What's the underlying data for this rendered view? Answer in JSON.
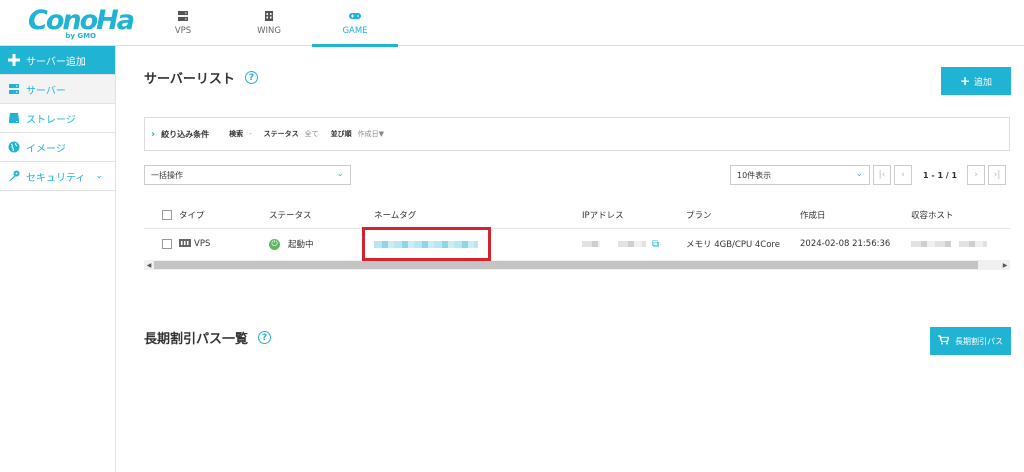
{
  "logo": {
    "text": "ConoHa",
    "sub": "by GMO"
  },
  "topnav": [
    {
      "label": "VPS",
      "icon": "server-icon"
    },
    {
      "label": "WING",
      "icon": "building-icon"
    },
    {
      "label": "GAME",
      "icon": "gamepad-icon"
    }
  ],
  "sidebar": {
    "items": [
      {
        "label": "サーバー追加",
        "icon": "plus-icon"
      },
      {
        "label": "サーバー",
        "icon": "server-icon"
      },
      {
        "label": "ストレージ",
        "icon": "storage-icon"
      },
      {
        "label": "イメージ",
        "icon": "image-icon"
      },
      {
        "label": "セキュリティ",
        "icon": "key-icon"
      }
    ]
  },
  "page": {
    "title": "サーバーリスト",
    "add_label": "追加",
    "filter": {
      "title": "絞り込み条件",
      "search_label": "検索",
      "search_value": "-",
      "status_label": "ステータス",
      "status_value": "全て",
      "sort_label": "並び順",
      "sort_value": "作成日▼"
    },
    "bulk_select": "一括操作",
    "perpage_select": "10件表示",
    "pager_info": "1 - 1 / 1"
  },
  "table": {
    "headers": [
      "タイプ",
      "ステータス",
      "ネームタグ",
      "IPアドレス",
      "プラン",
      "作成日",
      "収容ホスト"
    ],
    "row": {
      "type": "VPS",
      "status": "起動中",
      "plan": "メモリ 4GB/CPU 4Core",
      "created": "2024-02-08 21:56:36"
    }
  },
  "section": {
    "title": "長期割引パス一覧",
    "button_label": "長期割引パス"
  },
  "colors": {
    "accent": "#20b3d3",
    "running": "#5bb85d",
    "highlight": "#d6212f"
  }
}
